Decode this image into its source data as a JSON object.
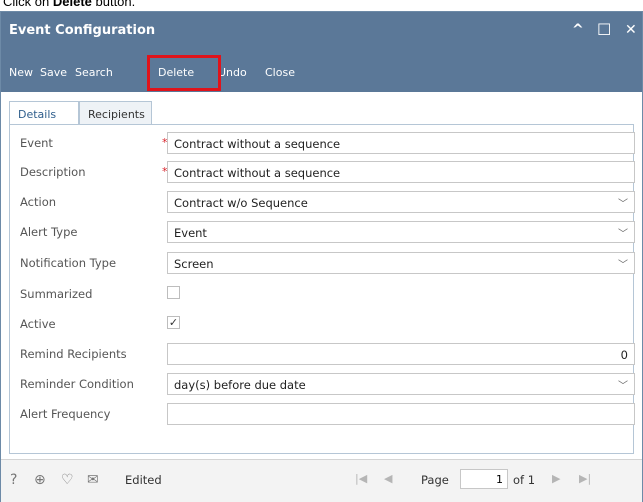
{
  "instruction": {
    "prefix": "Click on ",
    "bold": "Delete",
    "suffix": " button."
  },
  "window": {
    "title": "Event Configuration",
    "minimize_icon": "^",
    "maximize_icon": "☐",
    "close_icon": "✕"
  },
  "toolbar": {
    "new": "New",
    "save": "Save",
    "search": "Search",
    "delete": "Delete",
    "undo": "Undo",
    "close": "Close"
  },
  "tabs": {
    "details": "Details",
    "recipients": "Recipients"
  },
  "form": {
    "event": {
      "label": "Event",
      "value": "Contract without a sequence",
      "required": "*"
    },
    "description": {
      "label": "Description",
      "value": "Contract without a sequence",
      "required": "*"
    },
    "action": {
      "label": "Action",
      "value": "Contract w/o Sequence"
    },
    "alert_type": {
      "label": "Alert Type",
      "value": "Event"
    },
    "notification_type": {
      "label": "Notification Type",
      "value": "Screen"
    },
    "summarized": {
      "label": "Summarized",
      "checked": false
    },
    "active": {
      "label": "Active",
      "checked": "✓"
    },
    "remind_recipients": {
      "label": "Remind Recipients",
      "value": "0"
    },
    "reminder_condition": {
      "label": "Reminder Condition",
      "value": "day(s) before due date"
    },
    "alert_frequency": {
      "label": "Alert Frequency",
      "value": ""
    }
  },
  "status": {
    "text": "Edited",
    "page_label": "Page",
    "page_value": "1",
    "page_of": "of 1"
  },
  "colors": {
    "titlebar": "#5b7898",
    "highlight": "#e0131b",
    "required": "#d9222a"
  }
}
